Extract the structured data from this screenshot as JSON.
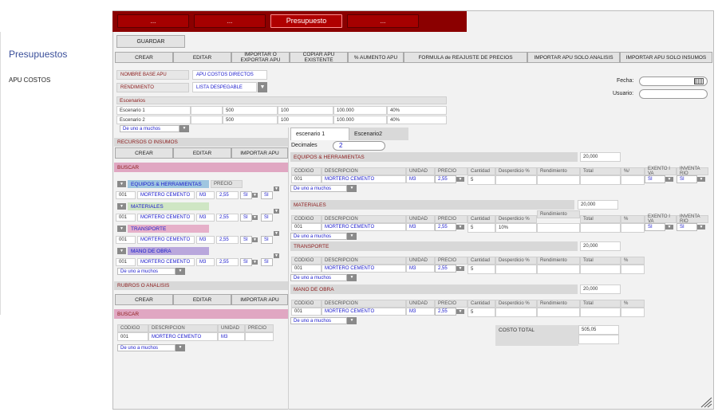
{
  "sidebar": {
    "title": "Presupuestos",
    "item": "APU COSTOS"
  },
  "topnav": {
    "tab1": "...",
    "tab2": "...",
    "tab3": "Presupuesto",
    "tab4": "..."
  },
  "toolbar": {
    "save": "GUARDAR",
    "crear": "CREAR",
    "editar": "EDITAR",
    "importar_exportar": "IMPORTAR O EXPORTAR  APU",
    "copiar": "COPIAR APU EXISTENTE",
    "aumento": "% AUMENTO APU",
    "formula": "FORMULA de  REAJUSTE DE PRECIOS",
    "imp_analisis": "IMPORTAR APU SOLO ANALISIS",
    "imp_insumos": "IMPORTAR APU SOLO INSUMOS"
  },
  "form": {
    "nombre_lbl": "NOMBRE BASE APU",
    "nombre_val": "APU COSTOS DIRECTOS",
    "rend_lbl": "RENDIMIENTO",
    "rend_val": "LISTA DESPEGABLE",
    "fecha_lbl": "Fecha:",
    "usuario_lbl": "Usuario:"
  },
  "escenarios": {
    "header": "Escenarios",
    "rows": [
      [
        "Escenario 1",
        "",
        "500",
        "100",
        "100.000",
        "40%"
      ],
      [
        "Escenario 2",
        "",
        "500",
        "100",
        "100.000",
        "40%"
      ]
    ],
    "paging": "De uno a muchos"
  },
  "recursos": {
    "title": "RECURSOS O INSUMOS",
    "crear": "CREAR",
    "editar": "EDITAR",
    "importar": "IMPORTAR APU",
    "buscar": "BUSCAR",
    "precio_hdr": "PRECIO",
    "groups": [
      {
        "name": "EQUIPOS & HERRAMIENTAS",
        "color": "#9fc6e0"
      },
      {
        "name": "MATERIALES",
        "color": "#cfe6c4"
      },
      {
        "name": "TRANSPORTE",
        "color": "#e6b0c9"
      },
      {
        "name": "MANO DE OBRA",
        "color": "#b9a7dc"
      }
    ],
    "row": {
      "code": "001",
      "desc": "MORTERO CEMENTO",
      "unit": "M3",
      "price": "2,55",
      "s1": "SI",
      "s2": "SI"
    },
    "paging": "De uno a muchos"
  },
  "rubros": {
    "title": "RUBROS O ANALISIS",
    "crear": "CREAR",
    "editar": "EDITAR",
    "importar": "IMPORTAR APU",
    "buscar": "BUSCAR",
    "cols": [
      "CODIGO",
      "DESCRIPCION",
      "UNIDAD",
      "PRECIO"
    ],
    "row": [
      "001",
      "MORTERO CEMENTO",
      "M3",
      ""
    ],
    "paging": "De uno a muchos"
  },
  "tabs": {
    "tab1": "escenario 1",
    "tab2": "Escenario2",
    "decimales_lbl": "Decimales",
    "decimales_val": "2"
  },
  "sections": [
    {
      "title": "EQUIPOS & HERRAMIENTAS",
      "total": "20,000",
      "cols": [
        "CODIGO",
        "DESCRIPCION",
        "UNIDAD",
        "PRECIO",
        "Cantidad",
        "Desperdicio %",
        "Rendimiento",
        "Total",
        "%/",
        "EXENTO I VA",
        "INVENTA RIO"
      ],
      "row": {
        "code": "001",
        "desc": "MORTERO CEMENTO",
        "unit": "M3",
        "price": "2,55",
        "qty": "5",
        "desp": "",
        "iva": "SI",
        "inv": "SI"
      },
      "paging": "De uno a muchos"
    },
    {
      "title": "MATERIALES",
      "total": "20,000",
      "cols": [
        "CODIGO",
        "DESCRIPCION",
        "UNIDAD",
        "PRECIO",
        "Cantidad",
        "Desperdicio %",
        "Rendimiento",
        "Total",
        "%",
        "EXENTO I VA",
        "INVENTA RIO"
      ],
      "row": {
        "code": "001",
        "desc": "MORTERO CEMENTO",
        "unit": "M3",
        "price": "2,55",
        "qty": "5",
        "desp": "10%",
        "iva": "SI",
        "inv": "SI"
      },
      "paging": "De uno a muchos"
    },
    {
      "title": "TRANSPORTE",
      "total": "20,000",
      "cols": [
        "CODIGO",
        "DESCRIPCION",
        "UNIDAD",
        "PRECIO",
        "Cantidad",
        "Desperdicio %",
        "Rendimiento",
        "Total",
        "%"
      ],
      "row": {
        "code": "001",
        "desc": "MORTERO CEMENTO",
        "unit": "M3",
        "price": "2,55",
        "qty": "5",
        "desp": ""
      },
      "paging": "De uno a muchos"
    },
    {
      "title": "MANO DE OBRA",
      "total": "20,000",
      "cols": [
        "CODIGO",
        "DESCRIPCION",
        "UNIDAD",
        "PRECIO",
        "Cantidad",
        "Desperdicio %",
        "Rendimiento",
        "Total",
        "%"
      ],
      "row": {
        "code": "001",
        "desc": "MORTERO CEMENTO",
        "unit": "M3",
        "price": "2,55",
        "qty": "5",
        "desp": ""
      },
      "paging": "De uno a muchos"
    }
  ],
  "costo": {
    "label": "COSTO TOTAL",
    "value": "505,05"
  }
}
